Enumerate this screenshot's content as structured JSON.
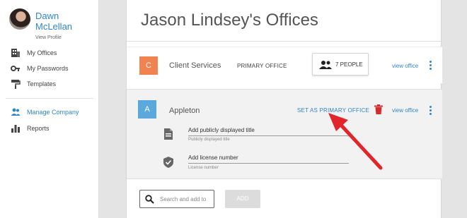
{
  "user": {
    "name": "Dawn McLellan",
    "view_profile": "View Profile"
  },
  "sidebar": {
    "items": [
      {
        "label": "My Offices",
        "icon": "building-icon"
      },
      {
        "label": "My Passwords",
        "icon": "key-icon"
      },
      {
        "label": "Templates",
        "icon": "paint-roller-icon"
      },
      {
        "label": "Manage Company",
        "icon": "people-icon",
        "active": true
      },
      {
        "label": "Reports",
        "icon": "bar-chart-icon"
      }
    ]
  },
  "page": {
    "title": "Jason Lindsey's Offices"
  },
  "offices": [
    {
      "tile_letter": "C",
      "tile_color": "#f0834f",
      "name": "Client Services",
      "status": "PRIMARY OFFICE",
      "people": "7 PEOPLE",
      "view_link": "view office"
    },
    {
      "tile_letter": "A",
      "tile_color": "#5aa9dd",
      "name": "Appleton",
      "set_primary": "SET AS PRIMARY OFFICE",
      "view_link": "view office",
      "fields": [
        {
          "value": "Add publicly displayed title",
          "help": "Publicly displayed title",
          "icon": "document-icon"
        },
        {
          "value": "Add license number",
          "help": "License number",
          "icon": "shield-check-icon"
        }
      ]
    }
  ],
  "search": {
    "placeholder": "Search and add to",
    "add_label": "ADD"
  },
  "colors": {
    "accent": "#2f86c8",
    "delete": "#d62b2b",
    "annotation_arrow": "#e0262b"
  }
}
